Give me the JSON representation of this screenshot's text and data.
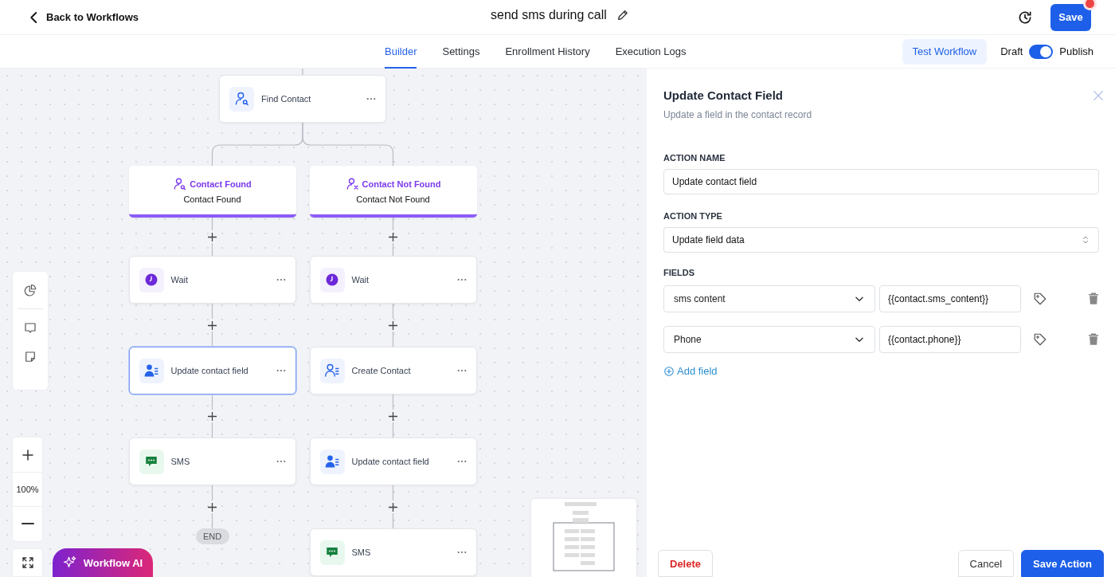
{
  "header": {
    "back_link": "Back to Workflows",
    "title": "send sms during call",
    "save_button": "Save"
  },
  "tabs": [
    {
      "label": "Builder",
      "selected": true
    },
    {
      "label": "Settings",
      "selected": false
    },
    {
      "label": "Enrollment History",
      "selected": false
    },
    {
      "label": "Execution Logs",
      "selected": false
    }
  ],
  "test_button": "Test Workflow",
  "publish_toggle": {
    "off_label": "Draft",
    "on_label": "Publish",
    "on": true
  },
  "canvas": {
    "trigger": {
      "kind": "find",
      "label": "Find Contact",
      "selected": false
    },
    "branches": [
      {
        "title": "Contact Found",
        "subtitle": "Contact Found",
        "kind": "found",
        "steps": [
          {
            "kind": "wait",
            "label": "Wait",
            "selected": false
          },
          {
            "kind": "update",
            "label": "Update contact field",
            "selected": true
          },
          {
            "kind": "sms",
            "label": "SMS",
            "selected": false
          },
          {
            "kind": "end",
            "label": "END"
          }
        ]
      },
      {
        "title": "Contact Not Found",
        "subtitle": "Contact Not Found",
        "kind": "not_found",
        "steps": [
          {
            "kind": "wait",
            "label": "Wait",
            "selected": false
          },
          {
            "kind": "create",
            "label": "Create Contact",
            "selected": false
          },
          {
            "kind": "update",
            "label": "Update contact field",
            "selected": false
          },
          {
            "kind": "sms",
            "label": "SMS",
            "selected": false
          }
        ]
      }
    ],
    "zoom_level": "100%",
    "ai_button": "Workflow AI"
  },
  "panel": {
    "title": "Update Contact Field",
    "subtitle": "Update a field in the contact record",
    "action_name": {
      "label": "ACTION NAME",
      "value": "Update contact field"
    },
    "action_type": {
      "label": "ACTION TYPE",
      "value": "Update field data"
    },
    "fields_label": "FIELDS",
    "fields": [
      {
        "field": "sms content",
        "value": "{{contact.sms_content}}"
      },
      {
        "field": "Phone",
        "value": "{{contact.phone}}"
      }
    ],
    "add_field": "Add field",
    "buttons": {
      "delete": "Delete",
      "cancel": "Cancel",
      "save": "Save Action"
    }
  }
}
